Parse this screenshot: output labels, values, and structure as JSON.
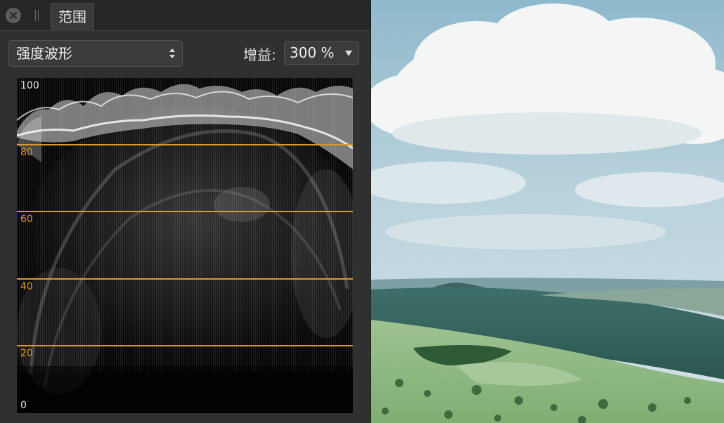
{
  "panel": {
    "tab_label": "范围",
    "mode_select": {
      "value": "强度波形"
    },
    "gain": {
      "label": "增益:",
      "value": "300 %"
    }
  },
  "scope": {
    "tick_labels": [
      "100",
      "80",
      "60",
      "40",
      "20",
      "0"
    ],
    "guide_levels": [
      80,
      60,
      40,
      20
    ],
    "guide_color": "#d89a2c"
  },
  "icons": {
    "close": "close-icon",
    "grip": "grip-icon",
    "stepper": "up-down-arrows-icon",
    "dropdown": "chevron-down-icon"
  }
}
